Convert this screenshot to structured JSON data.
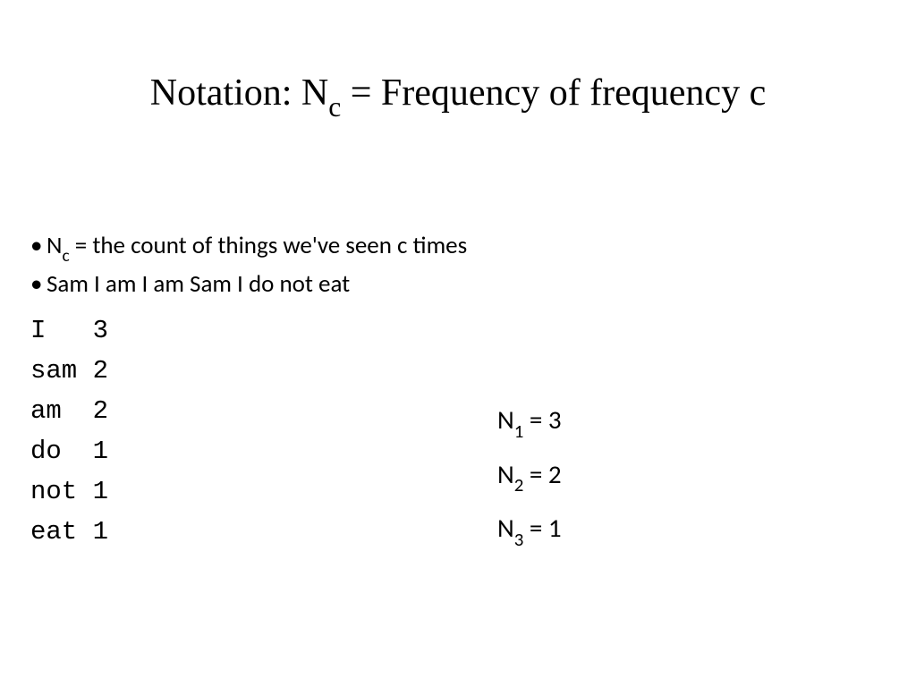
{
  "title": {
    "prefix": "Notation: N",
    "sub": "c",
    "suffix": " = Frequency of frequency c"
  },
  "bullets": {
    "b1_prefix": "N",
    "b1_sub": "c",
    "b1_suffix": " = the count of things we've seen c times",
    "b2": "Sam I am I am Sam I do not eat"
  },
  "word_counts": [
    {
      "word": "I",
      "count": "3"
    },
    {
      "word": "sam",
      "count": "2"
    },
    {
      "word": "am",
      "count": "2"
    },
    {
      "word": "do",
      "count": "1"
    },
    {
      "word": "not",
      "count": "1"
    },
    {
      "word": "eat",
      "count": "1"
    }
  ],
  "freq": [
    {
      "n": "N",
      "sub": "1",
      "val": " = 3"
    },
    {
      "n": "N",
      "sub": "2",
      "val": " = 2"
    },
    {
      "n": "N",
      "sub": "3",
      "val": " = 1"
    }
  ],
  "bullet_char": "•"
}
